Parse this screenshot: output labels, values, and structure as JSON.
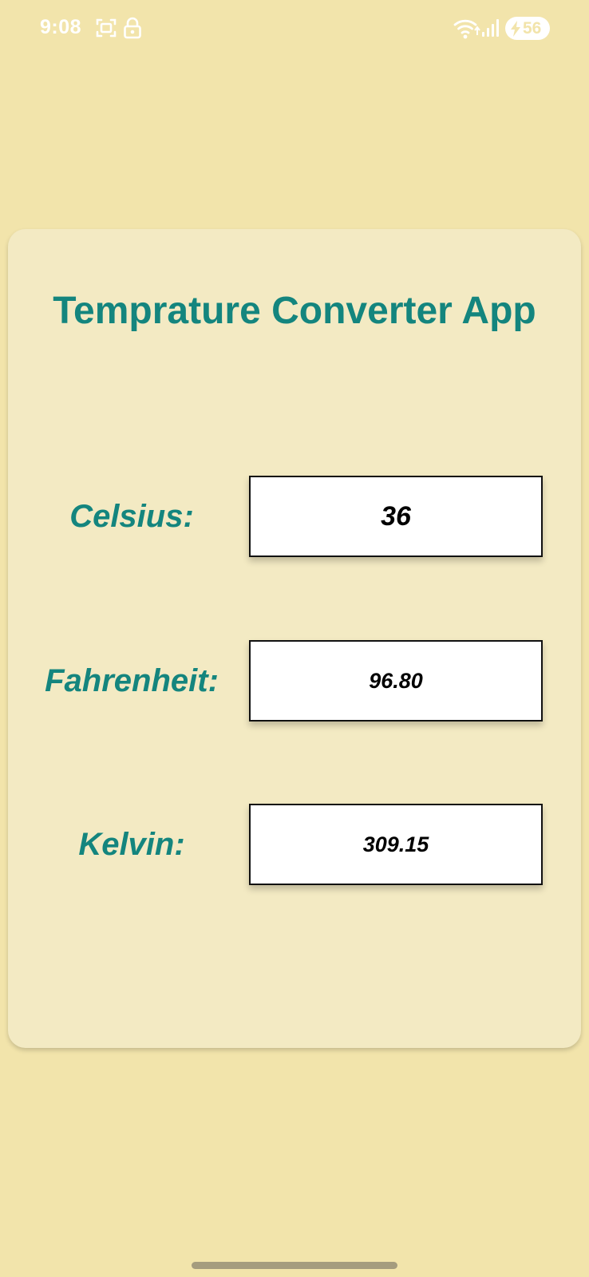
{
  "status_bar": {
    "time": "9:08",
    "battery_level": "56",
    "icons": [
      "screenshot-icon",
      "lock-icon",
      "wifi-icon",
      "signal-icon",
      "battery-icon"
    ]
  },
  "app": {
    "title": "Temprature Converter App"
  },
  "converter": {
    "celsius": {
      "label": "Celsius:",
      "value": "36"
    },
    "fahrenheit": {
      "label": "Fahrenheit:",
      "value": "96.80"
    },
    "kelvin": {
      "label": "Kelvin:",
      "value": "309.15"
    }
  },
  "colors": {
    "background": "#f2e4ab",
    "card": "#f3eac3",
    "accent": "#14857e"
  }
}
